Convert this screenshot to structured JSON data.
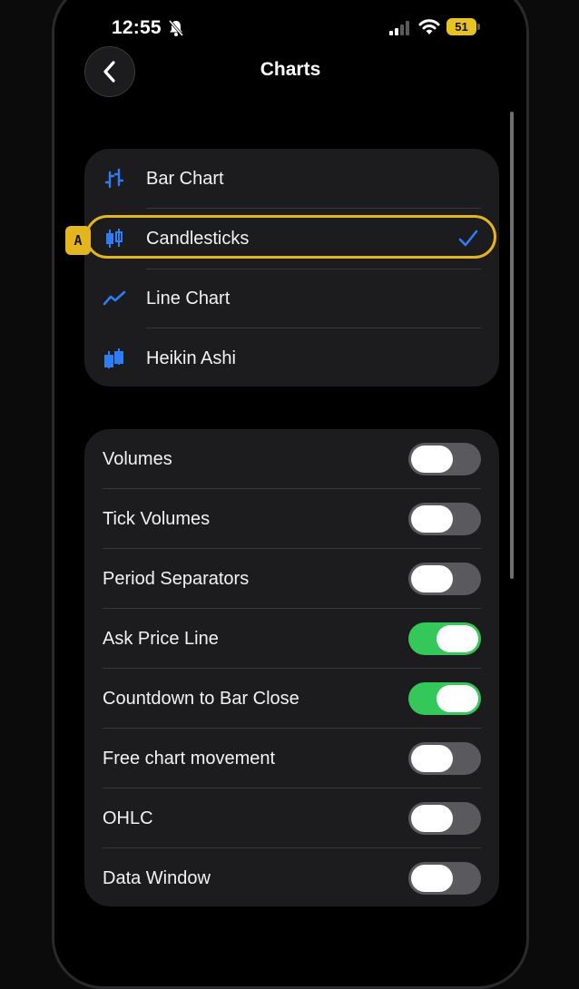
{
  "status_bar": {
    "time": "12:55",
    "battery": "51",
    "icons": [
      "bell-slash-icon",
      "cellular-signal-icon",
      "wifi-icon",
      "battery-icon"
    ]
  },
  "header": {
    "title": "Charts",
    "back_icon": "chevron-left-icon"
  },
  "chart_types": [
    {
      "label": "Bar Chart",
      "icon": "bar-chart-icon",
      "selected": false
    },
    {
      "label": "Candlesticks",
      "icon": "candlestick-icon",
      "selected": true
    },
    {
      "label": "Line Chart",
      "icon": "line-chart-icon",
      "selected": false
    },
    {
      "label": "Heikin Ashi",
      "icon": "heikin-ashi-icon",
      "selected": false
    }
  ],
  "marker": {
    "label": "A",
    "color": "#e3b61f"
  },
  "options": [
    {
      "label": "Volumes",
      "on": false
    },
    {
      "label": "Tick Volumes",
      "on": false
    },
    {
      "label": "Period Separators",
      "on": false
    },
    {
      "label": "Ask Price Line",
      "on": true
    },
    {
      "label": "Countdown to Bar Close",
      "on": true
    },
    {
      "label": "Free chart movement",
      "on": false
    },
    {
      "label": "OHLC",
      "on": false
    },
    {
      "label": "Data Window",
      "on": false
    }
  ],
  "colors": {
    "accent": "#2f7df6",
    "toggle_on": "#34c759",
    "toggle_off": "#5a5a5e",
    "highlight": "#e3b61f",
    "battery": "#e8c324"
  }
}
